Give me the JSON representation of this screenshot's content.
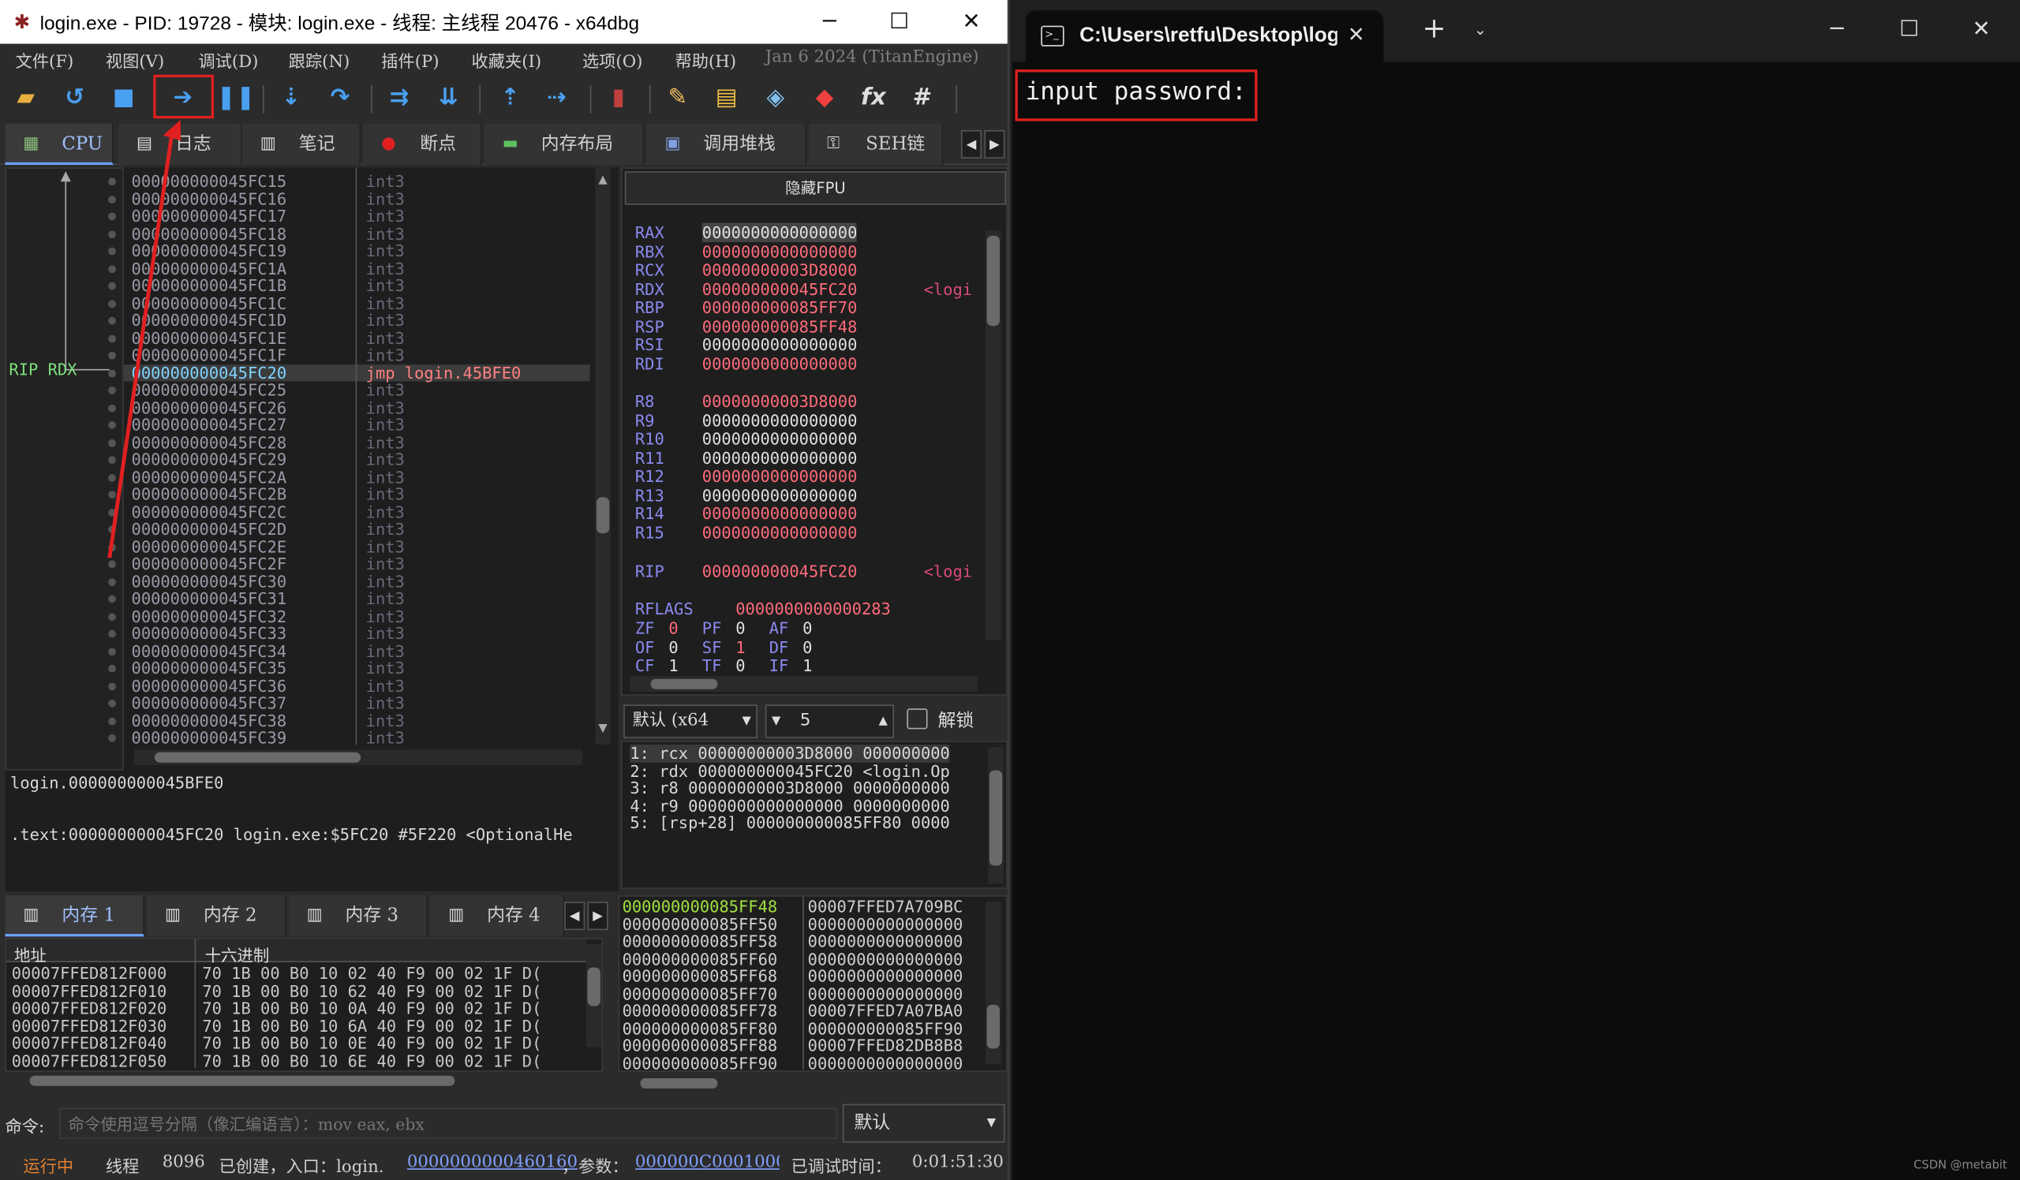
{
  "debugger": {
    "title": "login.exe - PID: 19728 - 模块: login.exe - 线程: 主线程 20476 - x64dbg",
    "menu": [
      "文件(F)",
      "视图(V)",
      "调试(D)",
      "跟踪(N)",
      "插件(P)",
      "收藏夹(I)",
      "选项(O)",
      "帮助(H)"
    ],
    "build_info": "Jan 6 2024 (TitanEngine)",
    "tabs": [
      "CPU",
      "日志",
      "笔记",
      "断点",
      "内存布局",
      "调用堆栈",
      "SEH链"
    ],
    "rip_label": "RIP RDX",
    "disasm": [
      {
        "addr": "000000000045FC15",
        "ins": "int3"
      },
      {
        "addr": "000000000045FC16",
        "ins": "int3"
      },
      {
        "addr": "000000000045FC17",
        "ins": "int3"
      },
      {
        "addr": "000000000045FC18",
        "ins": "int3"
      },
      {
        "addr": "000000000045FC19",
        "ins": "int3"
      },
      {
        "addr": "000000000045FC1A",
        "ins": "int3"
      },
      {
        "addr": "000000000045FC1B",
        "ins": "int3"
      },
      {
        "addr": "000000000045FC1C",
        "ins": "int3"
      },
      {
        "addr": "000000000045FC1D",
        "ins": "int3"
      },
      {
        "addr": "000000000045FC1E",
        "ins": "int3"
      },
      {
        "addr": "000000000045FC1F",
        "ins": "int3"
      },
      {
        "addr": "000000000045FC20",
        "ins": "jmp login.45BFE0",
        "current": true
      },
      {
        "addr": "000000000045FC25",
        "ins": "int3"
      },
      {
        "addr": "000000000045FC26",
        "ins": "int3"
      },
      {
        "addr": "000000000045FC27",
        "ins": "int3"
      },
      {
        "addr": "000000000045FC28",
        "ins": "int3"
      },
      {
        "addr": "000000000045FC29",
        "ins": "int3"
      },
      {
        "addr": "000000000045FC2A",
        "ins": "int3"
      },
      {
        "addr": "000000000045FC2B",
        "ins": "int3"
      },
      {
        "addr": "000000000045FC2C",
        "ins": "int3"
      },
      {
        "addr": "000000000045FC2D",
        "ins": "int3"
      },
      {
        "addr": "000000000045FC2E",
        "ins": "int3"
      },
      {
        "addr": "000000000045FC2F",
        "ins": "int3"
      },
      {
        "addr": "000000000045FC30",
        "ins": "int3"
      },
      {
        "addr": "000000000045FC31",
        "ins": "int3"
      },
      {
        "addr": "000000000045FC32",
        "ins": "int3"
      },
      {
        "addr": "000000000045FC33",
        "ins": "int3"
      },
      {
        "addr": "000000000045FC34",
        "ins": "int3"
      },
      {
        "addr": "000000000045FC35",
        "ins": "int3"
      },
      {
        "addr": "000000000045FC36",
        "ins": "int3"
      },
      {
        "addr": "000000000045FC37",
        "ins": "int3"
      },
      {
        "addr": "000000000045FC38",
        "ins": "int3"
      },
      {
        "addr": "000000000045FC39",
        "ins": "int3"
      }
    ],
    "fpu_button": "隐藏FPU",
    "registers": [
      {
        "name": "RAX",
        "value": "0000000000000000",
        "hl": true
      },
      {
        "name": "RBX",
        "value": "0000000000000000"
      },
      {
        "name": "RCX",
        "value": "00000000003D8000"
      },
      {
        "name": "RDX",
        "value": "000000000045FC20",
        "comment": "<logi"
      },
      {
        "name": "RBP",
        "value": "000000000085FF70"
      },
      {
        "name": "RSP",
        "value": "000000000085FF48"
      },
      {
        "name": "RSI",
        "value": "0000000000000000",
        "plain": true
      },
      {
        "name": "RDI",
        "value": "0000000000000000"
      },
      {
        "name": "R8",
        "value": "00000000003D8000"
      },
      {
        "name": "R9",
        "value": "0000000000000000",
        "plain": true
      },
      {
        "name": "R10",
        "value": "0000000000000000",
        "plain": true
      },
      {
        "name": "R11",
        "value": "0000000000000000",
        "plain": true
      },
      {
        "name": "R12",
        "value": "0000000000000000"
      },
      {
        "name": "R13",
        "value": "0000000000000000",
        "plain": true
      },
      {
        "name": "R14",
        "value": "0000000000000000"
      },
      {
        "name": "R15",
        "value": "0000000000000000"
      },
      {
        "name": "RIP",
        "value": "000000000045FC20",
        "comment": "<logi"
      }
    ],
    "rflags": {
      "name": "RFLAGS",
      "value": "0000000000000283"
    },
    "flags": [
      [
        {
          "n": "ZF",
          "v": "0"
        },
        {
          "n": "PF",
          "v": "0"
        },
        {
          "n": "AF",
          "v": "0"
        }
      ],
      [
        {
          "n": "OF",
          "v": "0"
        },
        {
          "n": "SF",
          "v": "1"
        },
        {
          "n": "DF",
          "v": "0"
        }
      ],
      [
        {
          "n": "CF",
          "v": "1"
        },
        {
          "n": "TF",
          "v": "0"
        },
        {
          "n": "IF",
          "v": "1"
        }
      ]
    ],
    "callconv": "默认 (x64",
    "argcount": "5",
    "unlock_label": "解锁",
    "args": [
      "1: rcx 00000000003D8000 000000000",
      "2: rdx 000000000045FC20 <login.Op",
      "3: r8 00000000003D8000 0000000000",
      "4: r9 0000000000000000 0000000000",
      "5: [rsp+28] 000000000085FF80 0000"
    ],
    "info_line1": "login.000000000045BFE0",
    "info_line2": ".text:000000000045FC20 login.exe:$5FC20 #5F220 <OptionalHe",
    "mem_tabs": [
      "内存 1",
      "内存 2",
      "内存 3",
      "内存 4"
    ],
    "dump_header_addr": "地址",
    "dump_header_hex": "十六进制",
    "dump": [
      {
        "addr": "00007FFED812F000",
        "hex": "70 1B 00 B0 10 02 40 F9 00 02 1F D("
      },
      {
        "addr": "00007FFED812F010",
        "hex": "70 1B 00 B0 10 62 40 F9 00 02 1F D("
      },
      {
        "addr": "00007FFED812F020",
        "hex": "70 1B 00 B0 10 0A 40 F9 00 02 1F D("
      },
      {
        "addr": "00007FFED812F030",
        "hex": "70 1B 00 B0 10 6A 40 F9 00 02 1F D("
      },
      {
        "addr": "00007FFED812F040",
        "hex": "70 1B 00 B0 10 0E 40 F9 00 02 1F D("
      },
      {
        "addr": "00007FFED812F050",
        "hex": "70 1B 00 B0 10 6E 40 F9 00 02 1F D("
      }
    ],
    "stack": [
      {
        "addr": "000000000085FF48",
        "val": "00007FFED7A709BC",
        "cur": true
      },
      {
        "addr": "000000000085FF50",
        "val": "0000000000000000"
      },
      {
        "addr": "000000000085FF58",
        "val": "0000000000000000"
      },
      {
        "addr": "000000000085FF60",
        "val": "0000000000000000"
      },
      {
        "addr": "000000000085FF68",
        "val": "0000000000000000"
      },
      {
        "addr": "000000000085FF70",
        "val": "0000000000000000"
      },
      {
        "addr": "000000000085FF78",
        "val": "00007FFED7A07BA0"
      },
      {
        "addr": "000000000085FF80",
        "val": "000000000085FF90"
      },
      {
        "addr": "000000000085FF88",
        "val": "00007FFED82DB8B8"
      },
      {
        "addr": "000000000085FF90",
        "val": "0000000000000000"
      }
    ],
    "cmd_label": "命令:",
    "cmd_placeholder": "命令使用逗号分隔（像汇编语言）：mov eax, ebx",
    "cmd_mode": "默认",
    "status": {
      "state": "运行中",
      "thread_label": "线程",
      "thread_id": "8096",
      "created": "已创建，入口：login.",
      "entry": "0000000000460160",
      "param_label": "，参数：",
      "param": "000000C000100000",
      "time_label": "已调试时间：",
      "time": "0:01:51:30"
    }
  },
  "terminal": {
    "tab_title": "C:\\Users\\retfu\\Desktop\\log",
    "output": "input password:"
  },
  "watermark": "CSDN @metabit"
}
